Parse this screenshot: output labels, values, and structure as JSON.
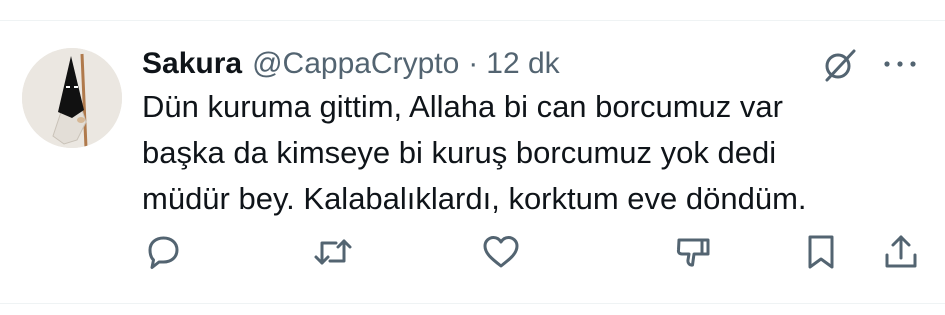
{
  "tweet": {
    "author_name": "Sakura",
    "handle": "@CappaCrypto",
    "separator": "·",
    "time": "12 dk",
    "text": "Dün kuruma gittim, Allaha bi can borcumuz var\nbaşka da kimseye bi kuruş borcumuz yok dedi\nmüdür bey. Kalabalıklardı, korktum eve döndüm."
  },
  "icons": {
    "grok": "grok-icon",
    "more": "more-horizontal-icon",
    "reply": "reply-icon",
    "retweet": "retweet-icon",
    "like": "heart-icon",
    "dislike": "thumbs-down-icon",
    "bookmark": "bookmark-icon",
    "share": "share-icon"
  },
  "colors": {
    "text": "#0f1419",
    "secondary": "#536471",
    "divider": "#eff3f4"
  }
}
